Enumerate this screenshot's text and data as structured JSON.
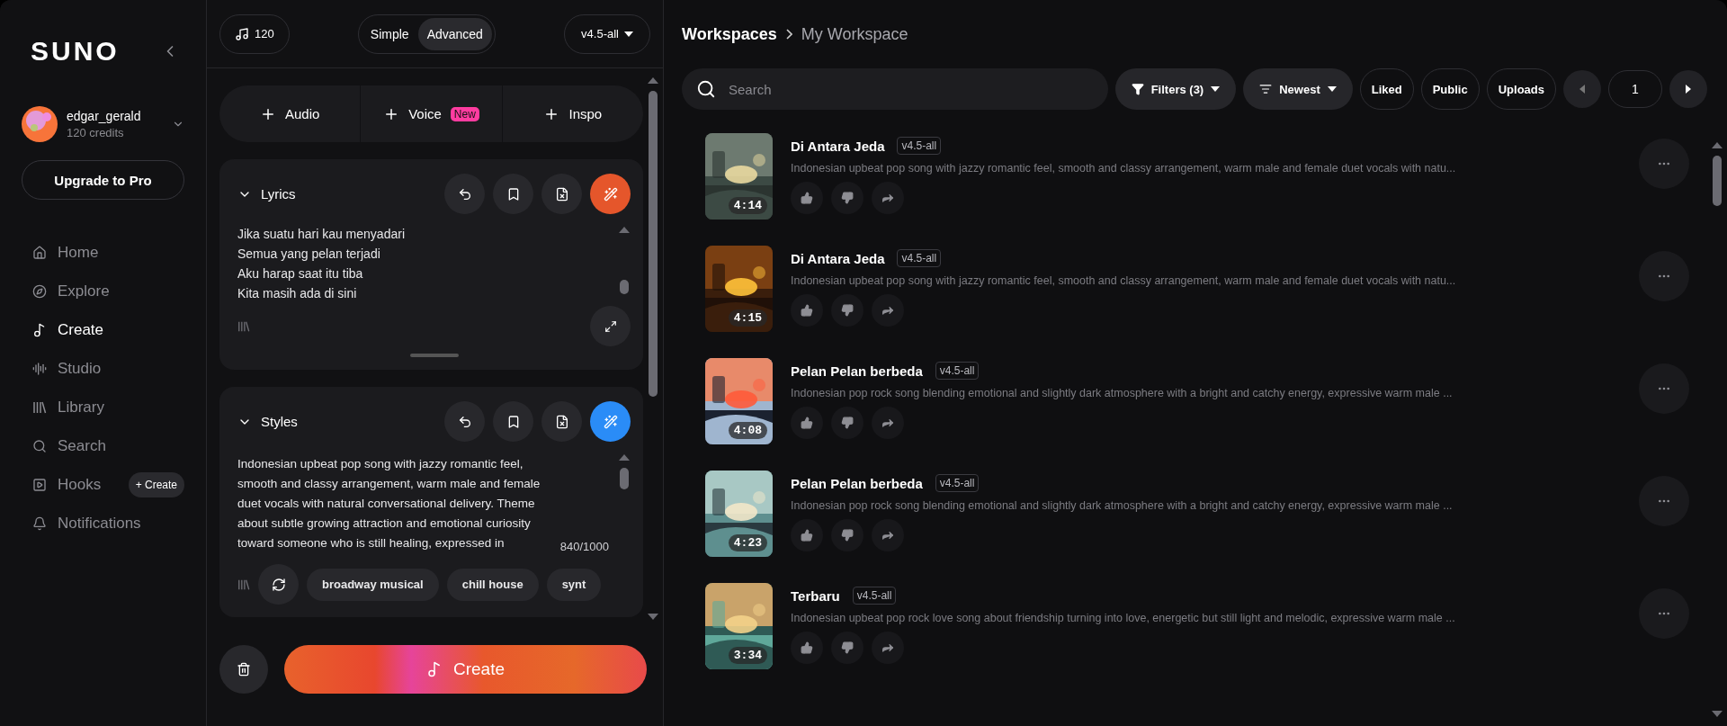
{
  "sidebar": {
    "logo": "SUNO",
    "user": {
      "name": "edgar_gerald",
      "credits": "120 credits"
    },
    "upgrade": "Upgrade to Pro",
    "nav": [
      {
        "label": "Home",
        "selected": false
      },
      {
        "label": "Explore",
        "selected": false
      },
      {
        "label": "Create",
        "selected": true
      },
      {
        "label": "Studio",
        "selected": false
      },
      {
        "label": "Library",
        "selected": false
      },
      {
        "label": "Search",
        "selected": false
      },
      {
        "label": "Hooks",
        "selected": false,
        "action": "+ Create"
      },
      {
        "label": "Notifications",
        "selected": false
      }
    ]
  },
  "create_panel": {
    "bpm": "120",
    "modes": [
      {
        "label": "Simple",
        "selected": false
      },
      {
        "label": "Advanced",
        "selected": true
      }
    ],
    "model": "v4.5-all",
    "add_buttons": [
      {
        "label": "Audio"
      },
      {
        "label": "Voice",
        "badge": "New"
      },
      {
        "label": "Inspo"
      }
    ],
    "sections": [
      {
        "kind": "lyrics",
        "title": "Lyrics",
        "expanded": true,
        "color": "#e5562b",
        "lines": [
          "Jika suatu hari kau menyadari",
          "Semua yang pelan terjadi",
          "Aku harap saat itu tiba",
          "Kita masih ada di sini"
        ]
      },
      {
        "kind": "styles",
        "title": "Styles",
        "expanded": true,
        "color": "#2a8cf7",
        "text": "Indonesian upbeat pop song with jazzy romantic feel, smooth and classy arrangement, warm male and female duet vocals with natural conversational delivery. Theme about subtle growing attraction and emotional curiosity toward someone who is still healing, expressed in",
        "counter": "840/1000",
        "tags": [
          "broadway musical",
          "chill house",
          "synt"
        ]
      }
    ],
    "create_button": "Create"
  },
  "library": {
    "breadcrumb": [
      "Workspaces",
      "My Workspace"
    ],
    "search": {
      "placeholder": "Search"
    },
    "filters": "Filters (3)",
    "sort": "Newest",
    "toggles": [
      {
        "label": "Liked",
        "selected": false
      },
      {
        "label": "Public",
        "selected": false
      },
      {
        "label": "Uploads",
        "selected": false
      }
    ],
    "page": "1",
    "songs": [
      {
        "title": "Di Antara Jeda",
        "version": "v4.5-all",
        "description": "Indonesian upbeat pop song with jazzy romantic feel, smooth and classy arrangement, warm male and female duet vocals with natu...",
        "duration": "4:14"
      },
      {
        "title": "Di Antara Jeda",
        "version": "v4.5-all",
        "description": "Indonesian upbeat pop song with jazzy romantic feel, smooth and classy arrangement, warm male and female duet vocals with natu...",
        "duration": "4:15"
      },
      {
        "title": "Pelan Pelan berbeda",
        "version": "v4.5-all",
        "description": "Indonesian pop rock song blending emotional and slightly dark atmosphere with a bright and catchy energy, expressive warm male ...",
        "duration": "4:08"
      },
      {
        "title": "Pelan Pelan berbeda",
        "version": "v4.5-all",
        "description": "Indonesian pop rock song blending emotional and slightly dark atmosphere with a bright and catchy energy, expressive warm male ...",
        "duration": "4:23"
      },
      {
        "title": "Terbaru",
        "version": "v4.5-all",
        "description": "Indonesian upbeat pop rock love song about friendship turning into love, energetic but still light and melodic, expressive warm male ...",
        "duration": "3:34"
      }
    ]
  }
}
